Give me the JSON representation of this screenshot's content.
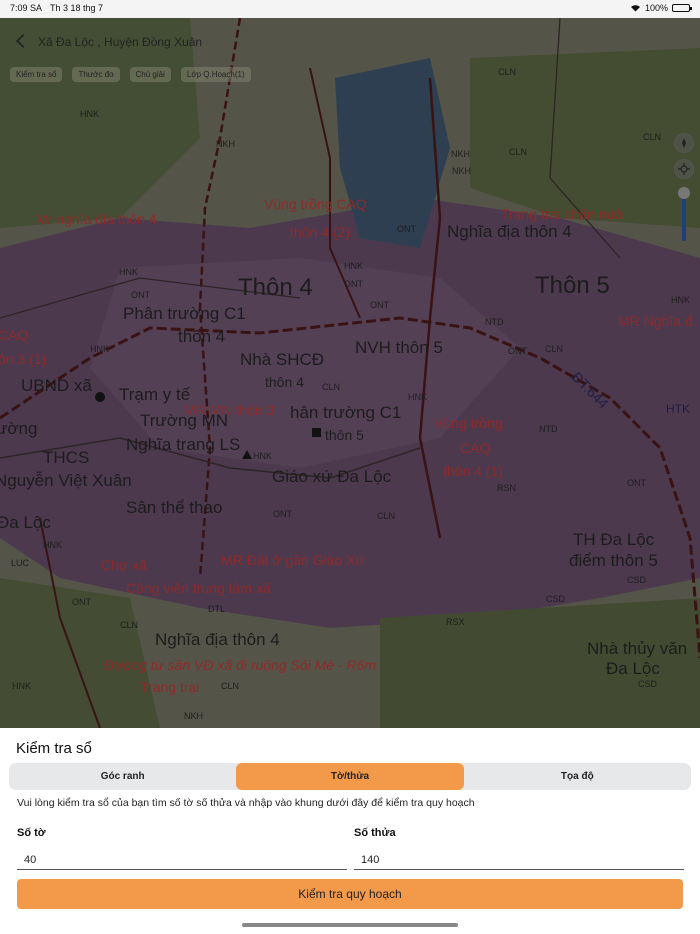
{
  "status": {
    "time": "7:09 SA",
    "date": "Th 3 18 thg 7",
    "battery": "100%"
  },
  "nav": {
    "location_title": "Xã Đa Lộc , Huyện Đồng Xuân"
  },
  "chips": [
    "Kiểm tra sổ",
    "Thước đo",
    "Chú giải",
    "Lớp Q.Hoạch(1)"
  ],
  "map_labels": {
    "big": [
      "Thôn 4",
      "Thôn 5"
    ],
    "places": [
      "Phân trường C1",
      "thôn 4",
      "Nhà SHCĐ",
      "thôn 4",
      "NVH thôn 5",
      "Trạm y tế",
      "Trường MN",
      "Nghĩa trang LS",
      "THCS",
      "Nguyễn Việt Xuân",
      "Sân thể thao",
      "Giáo xứ Đa Lộc",
      "hân trường C1",
      "thôn 5",
      "Nghĩa địa thôn 4",
      "Nghĩa địa thôn 4",
      "TH Đa Lộc",
      "điểm thôn 5",
      "Nhà thủy văn",
      "Đa Lộc",
      "UBND xã",
      "Đa Lộc",
      "ường"
    ],
    "zones": [
      "Mr nghĩa địa thôn 4",
      "Vùng trồng CAQ",
      "thôn 4 (2)",
      "Trang trại chăn nuôi",
      "MR Nghĩa đ",
      "MR MN thôn 3",
      "Vùng trồng",
      "CAQ",
      "thôn 4 (1)",
      "MR Đất ở gần Giáo Xứ",
      "Công viên trung tâm xã",
      "Chợ xã",
      "Đường từ sân VĐ xã đi ruộng Sói Mè - R6m",
      "Trang trại",
      "CAQ",
      "ôn 3 (1)",
      "ĐT.644"
    ],
    "codes": [
      "HNK",
      "CLN",
      "NKH",
      "NKH",
      "NKH",
      "CLN",
      "CLN",
      "ONT",
      "HNK",
      "HNK",
      "ONT",
      "ONT",
      "NTD",
      "ONT",
      "CLN",
      "HNK",
      "HNK",
      "CLN",
      "NTD",
      "HNK",
      "ONT",
      "RSN",
      "ONT",
      "CLN",
      "RSX",
      "CSD",
      "CSD",
      "HTK",
      "DTL",
      "CLN",
      "HNK",
      "NKH",
      "CLN",
      "ONT",
      "HNK",
      "CSD",
      "LUC",
      "ONT",
      "HNK"
    ]
  },
  "tools": {
    "compass": "compass-icon",
    "locate": "locate-icon"
  },
  "sheet": {
    "title": "Kiểm tra sổ",
    "tabs": [
      "Góc ranh",
      "Tờ/thửa",
      "Tọa độ"
    ],
    "active_tab": 1,
    "helper": "Vui lòng kiểm tra sổ của bạn tìm số tờ số thửa và nhập vào khung dưới đây để kiểm tra quy hoạch",
    "so_to": {
      "label": "Số tờ",
      "value": "40"
    },
    "so_thua": {
      "label": "Số thửa",
      "value": "140"
    },
    "submit": "Kiểm tra quy hoạch"
  },
  "colors": {
    "accent": "#f29a4a",
    "segment_bg": "#e6e8ea"
  }
}
